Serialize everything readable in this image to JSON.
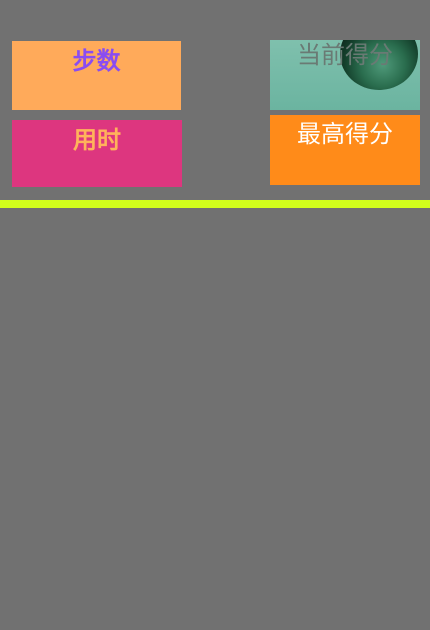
{
  "stats": {
    "steps_label": "步数",
    "time_label": "用时",
    "current_score_label": "当前得分",
    "best_score_label": "最高得分"
  },
  "colors": {
    "background": "#717171",
    "steps_panel": "#ffaa5a",
    "steps_text": "#8a4cf2",
    "time_panel": "#dd367f",
    "time_text": "#ffb35b",
    "current_score_panel": "#6bb4a0",
    "best_score_panel": "#ff8b19",
    "divider": "#d2ff1c"
  }
}
